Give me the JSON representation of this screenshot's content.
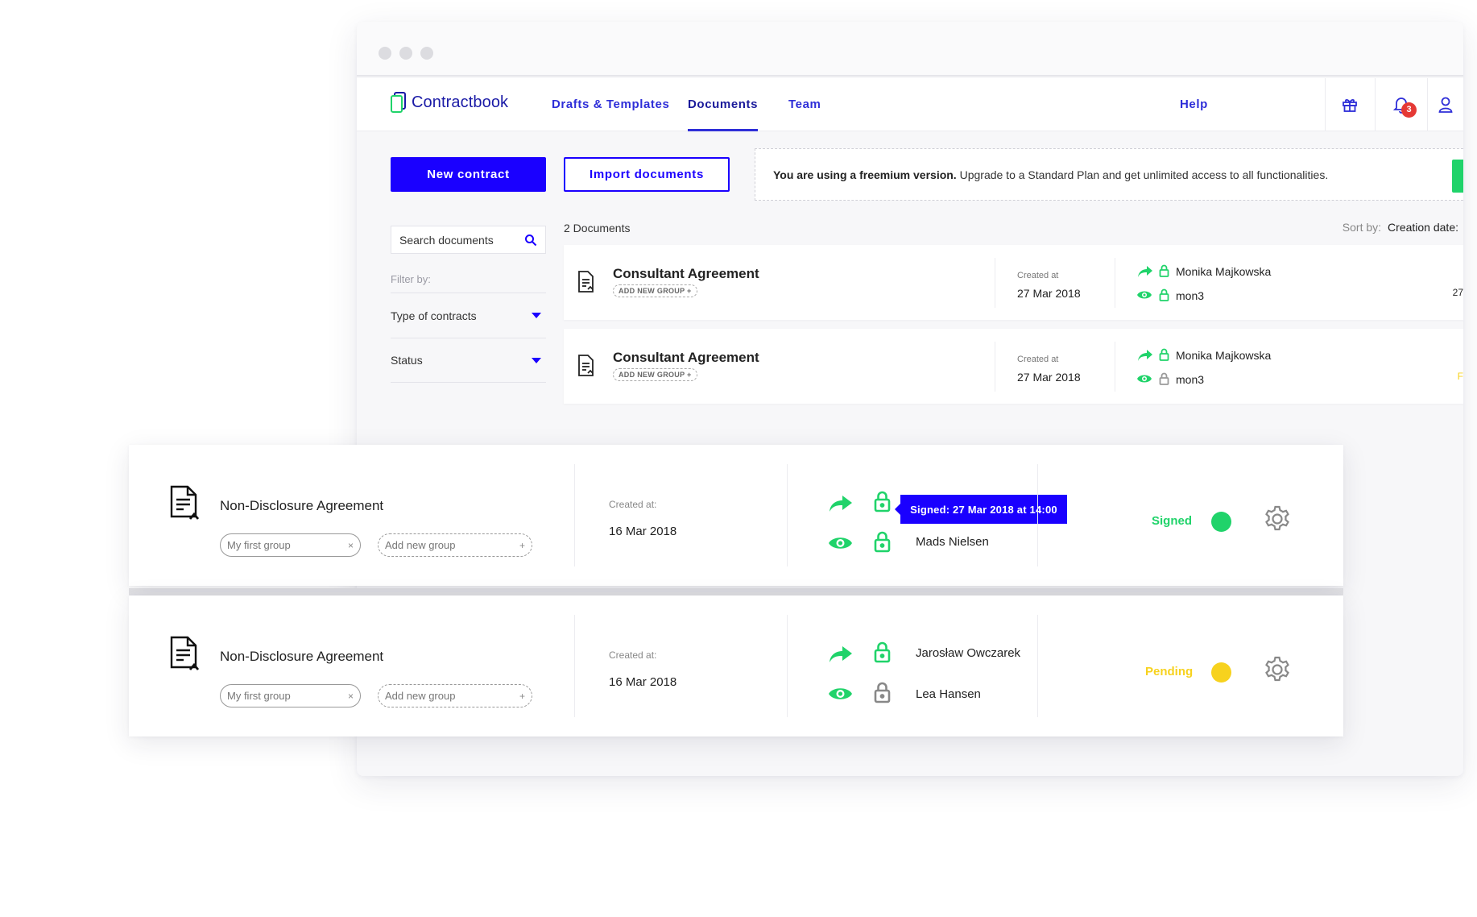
{
  "brand": {
    "name": "Contractbook",
    "color": "#1a1aa6",
    "logo_icon": "document-logo-icon"
  },
  "nav": {
    "items": [
      {
        "label": "Drafts & Templates",
        "active": false
      },
      {
        "label": "Documents",
        "active": true
      },
      {
        "label": "Team",
        "active": false
      }
    ],
    "help_label": "Help",
    "notification_count": "3",
    "icons": [
      "gift-icon",
      "bell-icon",
      "user-icon"
    ]
  },
  "actions": {
    "new_contract": "New contract",
    "import_documents": "Import documents"
  },
  "banner": {
    "bold": "You are using a freemium version.",
    "text": " Upgrade to a Standard Plan and get unlimited access to all functionalities."
  },
  "sidebar": {
    "search_placeholder": "Search documents",
    "filter_label": "Filter by:",
    "filters": [
      {
        "label": "Type of contracts"
      },
      {
        "label": "Status"
      }
    ]
  },
  "list": {
    "count": "2 Documents",
    "sort_label": "Sort by:",
    "sort_value": "Creation date:"
  },
  "bg_documents": [
    {
      "title": "Consultant Agreement",
      "group_chip": "ADD NEW GROUP +",
      "created_label": "Created at",
      "created_date": "27 Mar 2018",
      "sender": "Monika Majkowska",
      "viewer": "mon3",
      "edge_text": "27"
    },
    {
      "title": "Consultant Agreement",
      "group_chip": "ADD NEW GROUP +",
      "created_label": "Created at",
      "created_date": "27 Mar 2018",
      "sender": "Monika Majkowska",
      "viewer": "mon3",
      "edge_text": "F"
    }
  ],
  "fg_documents": [
    {
      "title": "Non-Disclosure Agreement",
      "group": "My first group",
      "group_remove": "×",
      "add_group": "Add new group",
      "add_group_plus": "+",
      "created_label": "Created at:",
      "created_date": "16 Mar 2018",
      "tooltip": "Signed: 27 Mar 2018 at 14:00",
      "signer_top": "",
      "signer_bottom": "Mads Nielsen",
      "status": "Signed",
      "status_color": "#20d36a"
    },
    {
      "title": "Non-Disclosure Agreement",
      "group": "My first group",
      "group_remove": "×",
      "add_group": "Add new group",
      "add_group_plus": "+",
      "created_label": "Created at:",
      "created_date": "16 Mar 2018",
      "tooltip": "",
      "signer_top": "Jarosław Owczarek",
      "signer_bottom": "Lea Hansen",
      "status": "Pending",
      "status_color": "#f7d21e"
    }
  ],
  "colors": {
    "accent": "#1a00ff",
    "green": "#20d36a",
    "yellow": "#f7d21e",
    "badge": "#e53935"
  }
}
